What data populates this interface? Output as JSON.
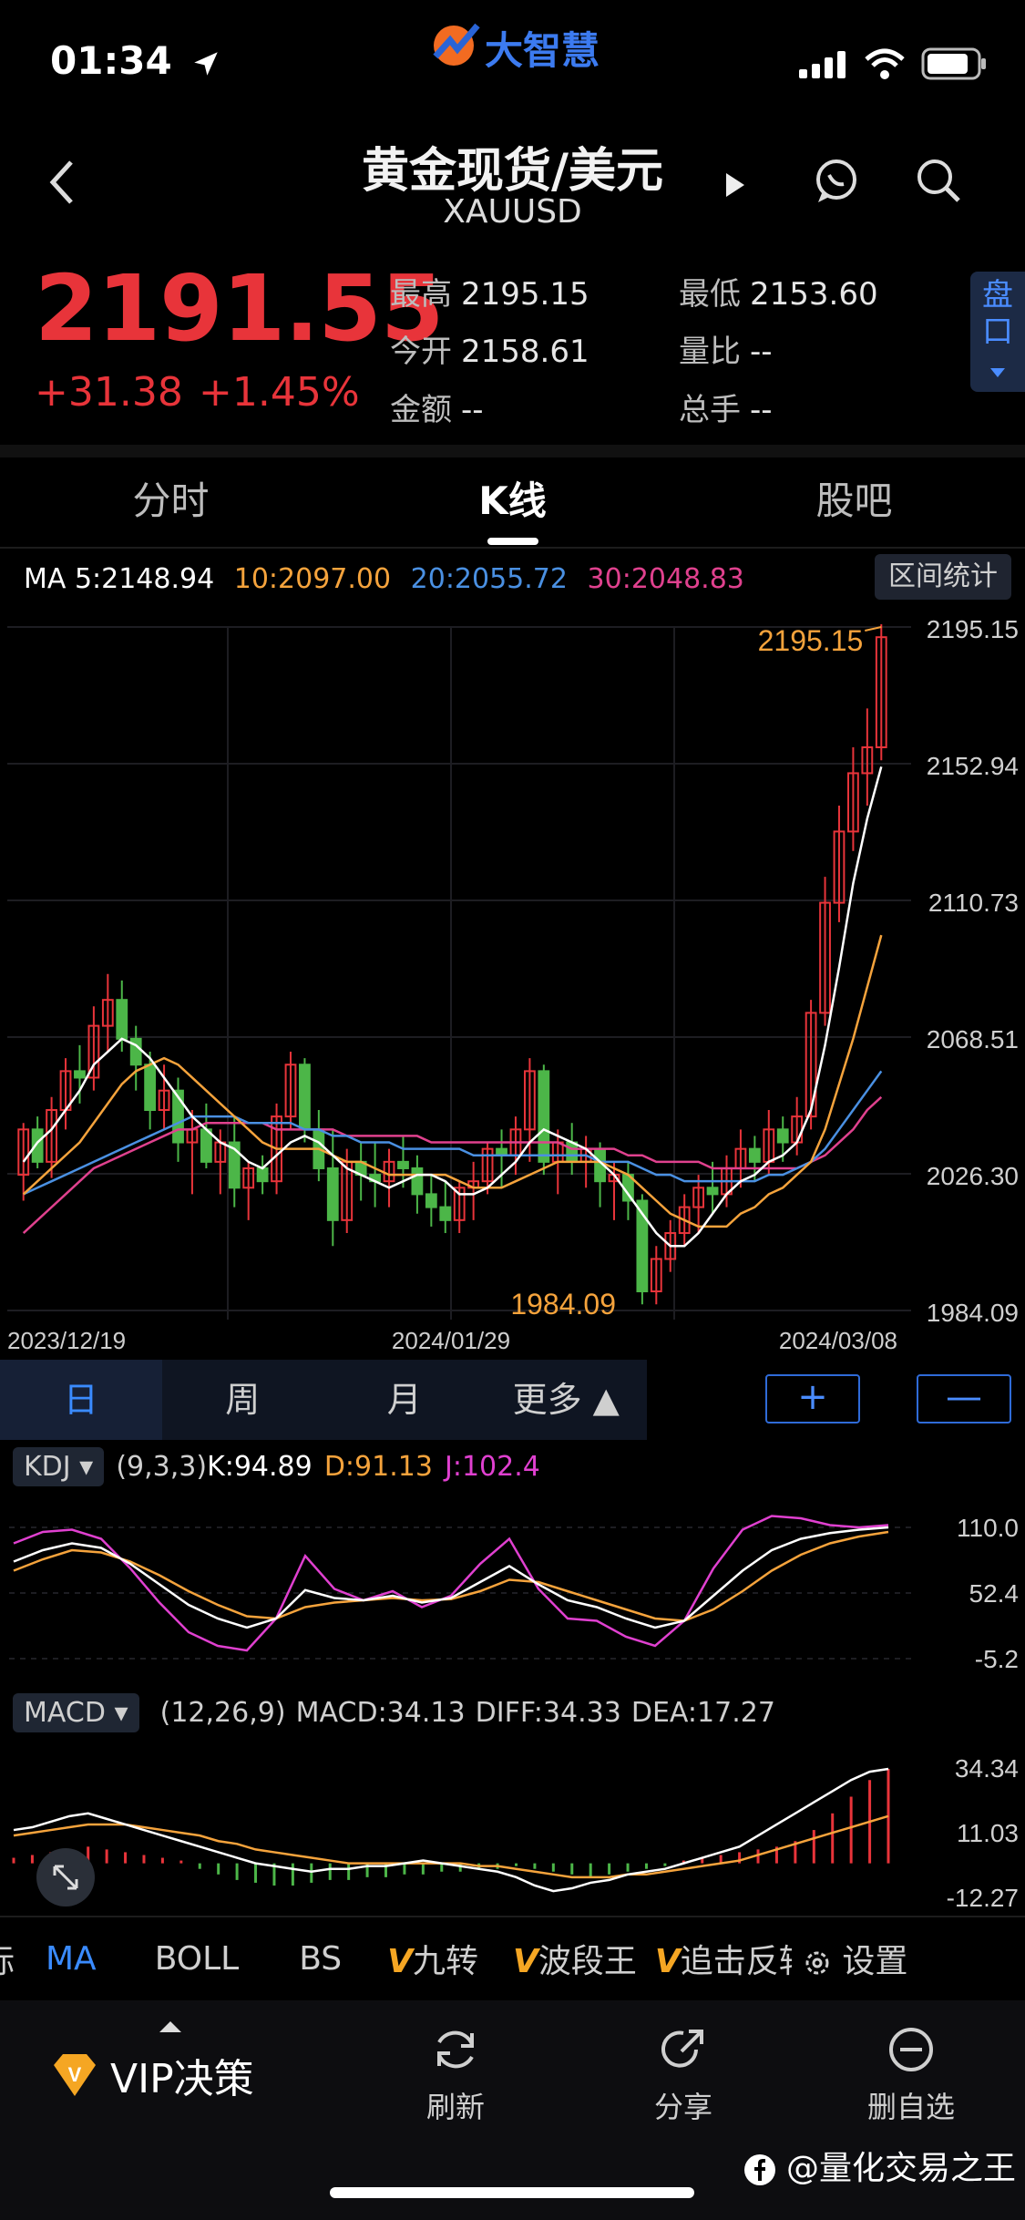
{
  "status": {
    "time": "01:34"
  },
  "app": {
    "logo_text": "大智慧"
  },
  "header": {
    "title": "黄金现货/美元",
    "symbol": "XAUUSD"
  },
  "quote": {
    "price": "2191.55",
    "change": "+31.38",
    "change_pct": "+1.45%",
    "stats": {
      "high_label": "最高",
      "high": "2195.15",
      "low_label": "最低",
      "low": "2153.60",
      "open_label": "今开",
      "open": "2158.61",
      "ratio_label": "量比",
      "ratio": "--",
      "amount_label": "金额",
      "amount": "--",
      "volume_label": "总手",
      "volume": "--"
    },
    "pankou": "盘口"
  },
  "tabs": [
    {
      "label": "分时"
    },
    {
      "label": "K线"
    },
    {
      "label": "股吧"
    }
  ],
  "ma_legend": {
    "ma5": "MA 5:2148.94",
    "ma10": "10:2097.00",
    "ma20": "20:2055.72",
    "ma30": "30:2048.83"
  },
  "range_stats_label": "区间统计",
  "colors": {
    "up": "#e8343a",
    "down": "#4cb648",
    "ma5": "#ffffff",
    "ma10": "#f5a33c",
    "ma20": "#4a90e2",
    "ma30": "#e0418e",
    "accent": "#3a8bff"
  },
  "chart_data": {
    "type": "candlestick",
    "y_ticks": [
      "2195.15",
      "2152.94",
      "2110.73",
      "2068.51",
      "2026.30",
      "1984.09"
    ],
    "x_ticks": [
      "2023/12/19",
      "2024/01/29",
      "2024/03/08"
    ],
    "max_label": "2195.15",
    "min_label": "1984.09",
    "ylim": [
      1984.09,
      2195.15
    ],
    "candles": [
      [
        2026,
        2042,
        2018,
        2040
      ],
      [
        2040,
        2044,
        2028,
        2030
      ],
      [
        2030,
        2050,
        2025,
        2046
      ],
      [
        2046,
        2062,
        2040,
        2058
      ],
      [
        2058,
        2066,
        2048,
        2056
      ],
      [
        2056,
        2078,
        2052,
        2072
      ],
      [
        2072,
        2088,
        2064,
        2080
      ],
      [
        2080,
        2086,
        2064,
        2068
      ],
      [
        2068,
        2072,
        2052,
        2060
      ],
      [
        2060,
        2064,
        2040,
        2046
      ],
      [
        2046,
        2060,
        2040,
        2052
      ],
      [
        2052,
        2056,
        2030,
        2036
      ],
      [
        2036,
        2046,
        2020,
        2040
      ],
      [
        2040,
        2048,
        2028,
        2030
      ],
      [
        2030,
        2040,
        2020,
        2036
      ],
      [
        2036,
        2044,
        2016,
        2022
      ],
      [
        2022,
        2030,
        2012,
        2028
      ],
      [
        2028,
        2032,
        2020,
        2024
      ],
      [
        2024,
        2048,
        2020,
        2044
      ],
      [
        2044,
        2064,
        2040,
        2060
      ],
      [
        2060,
        2062,
        2036,
        2040
      ],
      [
        2040,
        2046,
        2024,
        2028
      ],
      [
        2028,
        2040,
        2004,
        2012
      ],
      [
        2012,
        2034,
        2008,
        2030
      ],
      [
        2030,
        2036,
        2018,
        2026
      ],
      [
        2026,
        2036,
        2016,
        2024
      ],
      [
        2024,
        2034,
        2016,
        2030
      ],
      [
        2030,
        2038,
        2022,
        2028
      ],
      [
        2028,
        2032,
        2014,
        2020
      ],
      [
        2020,
        2026,
        2010,
        2016
      ],
      [
        2016,
        2024,
        2008,
        2012
      ],
      [
        2012,
        2024,
        2008,
        2022
      ],
      [
        2022,
        2030,
        2012,
        2024
      ],
      [
        2024,
        2036,
        2020,
        2034
      ],
      [
        2034,
        2040,
        2022,
        2032
      ],
      [
        2032,
        2044,
        2026,
        2040
      ],
      [
        2040,
        2062,
        2030,
        2058
      ],
      [
        2058,
        2060,
        2026,
        2030
      ],
      [
        2030,
        2040,
        2020,
        2036
      ],
      [
        2036,
        2042,
        2026,
        2030
      ],
      [
        2030,
        2038,
        2022,
        2034
      ],
      [
        2034,
        2036,
        2016,
        2024
      ],
      [
        2024,
        2030,
        2012,
        2026
      ],
      [
        2026,
        2030,
        2012,
        2018
      ],
      [
        2018,
        2020,
        1986,
        1990
      ],
      [
        1990,
        2004,
        1986,
        2000
      ],
      [
        2000,
        2012,
        1996,
        2008
      ],
      [
        2008,
        2020,
        2004,
        2016
      ],
      [
        2016,
        2026,
        2008,
        2022
      ],
      [
        2022,
        2030,
        2014,
        2020
      ],
      [
        2020,
        2032,
        2016,
        2028
      ],
      [
        2028,
        2040,
        2022,
        2034
      ],
      [
        2034,
        2038,
        2024,
        2030
      ],
      [
        2030,
        2046,
        2026,
        2040
      ],
      [
        2040,
        2044,
        2030,
        2036
      ],
      [
        2036,
        2050,
        2032,
        2044
      ],
      [
        2044,
        2080,
        2040,
        2076
      ],
      [
        2076,
        2118,
        2072,
        2110
      ],
      [
        2110,
        2140,
        2104,
        2132
      ],
      [
        2132,
        2158,
        2126,
        2150
      ],
      [
        2150,
        2170,
        2140,
        2158
      ],
      [
        2158,
        2196,
        2154,
        2192
      ]
    ],
    "ma5": [
      2030,
      2036,
      2040,
      2046,
      2052,
      2060,
      2064,
      2068,
      2066,
      2062,
      2056,
      2050,
      2044,
      2040,
      2036,
      2034,
      2030,
      2028,
      2032,
      2036,
      2038,
      2036,
      2032,
      2028,
      2026,
      2024,
      2022,
      2024,
      2026,
      2026,
      2024,
      2020,
      2020,
      2022,
      2026,
      2030,
      2036,
      2040,
      2038,
      2036,
      2034,
      2030,
      2026,
      2020,
      2014,
      2008,
      2004,
      2004,
      2008,
      2014,
      2020,
      2024,
      2026,
      2030,
      2032,
      2036,
      2046,
      2066,
      2090,
      2116,
      2136,
      2152
    ],
    "ma10": [
      2020,
      2024,
      2028,
      2032,
      2036,
      2042,
      2048,
      2054,
      2058,
      2060,
      2062,
      2060,
      2056,
      2052,
      2048,
      2044,
      2040,
      2036,
      2034,
      2034,
      2034,
      2034,
      2032,
      2030,
      2030,
      2028,
      2026,
      2026,
      2026,
      2026,
      2026,
      2024,
      2022,
      2022,
      2022,
      2024,
      2026,
      2028,
      2030,
      2030,
      2030,
      2030,
      2028,
      2026,
      2022,
      2018,
      2014,
      2012,
      2010,
      2010,
      2010,
      2014,
      2016,
      2020,
      2022,
      2026,
      2030,
      2040,
      2054,
      2068,
      2084,
      2100
    ],
    "ma20": [
      2020,
      2022,
      2024,
      2026,
      2028,
      2030,
      2032,
      2034,
      2036,
      2038,
      2040,
      2042,
      2044,
      2044,
      2044,
      2044,
      2042,
      2042,
      2042,
      2042,
      2040,
      2040,
      2038,
      2038,
      2036,
      2036,
      2036,
      2034,
      2034,
      2034,
      2034,
      2034,
      2032,
      2032,
      2032,
      2032,
      2032,
      2032,
      2032,
      2032,
      2032,
      2030,
      2030,
      2030,
      2028,
      2026,
      2026,
      2024,
      2024,
      2024,
      2024,
      2024,
      2024,
      2026,
      2026,
      2028,
      2030,
      2034,
      2040,
      2046,
      2052,
      2058
    ],
    "ma30": [
      2008,
      2012,
      2016,
      2020,
      2024,
      2028,
      2030,
      2032,
      2034,
      2036,
      2038,
      2040,
      2040,
      2042,
      2042,
      2042,
      2042,
      2042,
      2040,
      2040,
      2040,
      2040,
      2040,
      2038,
      2038,
      2038,
      2038,
      2038,
      2038,
      2036,
      2036,
      2036,
      2036,
      2036,
      2036,
      2036,
      2036,
      2036,
      2036,
      2034,
      2034,
      2034,
      2034,
      2032,
      2032,
      2030,
      2030,
      2030,
      2030,
      2028,
      2028,
      2028,
      2028,
      2028,
      2028,
      2028,
      2030,
      2032,
      2036,
      2040,
      2046,
      2050
    ]
  },
  "periods": [
    {
      "label": "日"
    },
    {
      "label": "周"
    },
    {
      "label": "月"
    },
    {
      "label": "更多 ▲"
    }
  ],
  "zoom": {
    "plus": "+",
    "minus": "—"
  },
  "kdj": {
    "tag": "KDJ ▾",
    "params": "(9,3,3)",
    "k": "K:94.89",
    "d": "D:91.13",
    "j": "J:102.4",
    "y_ticks": [
      "110.0",
      "52.4",
      "-5.2"
    ],
    "ylim": [
      -5.2,
      110.0
    ],
    "k_series": [
      80,
      90,
      96,
      92,
      78,
      60,
      42,
      30,
      22,
      30,
      55,
      48,
      46,
      50,
      44,
      48,
      62,
      76,
      60,
      46,
      40,
      30,
      22,
      28,
      50,
      72,
      90,
      100,
      105,
      108,
      110
    ],
    "d_series": [
      72,
      82,
      90,
      88,
      80,
      68,
      54,
      42,
      32,
      30,
      40,
      44,
      46,
      48,
      46,
      47,
      54,
      64,
      62,
      54,
      46,
      38,
      30,
      28,
      38,
      54,
      72,
      86,
      96,
      102,
      106
    ],
    "j_series": [
      96,
      106,
      108,
      100,
      74,
      44,
      18,
      6,
      2,
      30,
      85,
      56,
      46,
      54,
      40,
      50,
      78,
      100,
      56,
      30,
      28,
      14,
      6,
      28,
      74,
      108,
      120,
      118,
      112,
      110,
      112
    ]
  },
  "macd": {
    "tag": "MACD ▾",
    "params": "(12,26,9)",
    "macd": "MACD:34.13",
    "diff": "DIFF:34.33",
    "dea": "DEA:17.27",
    "y_ticks": [
      "34.34",
      "11.03",
      "-12.27"
    ],
    "ylim": [
      -12.27,
      34.34
    ],
    "hist": [
      2,
      3,
      4,
      5,
      6,
      5,
      4,
      3,
      2,
      1,
      -2,
      -4,
      -6,
      -7,
      -8,
      -8,
      -7,
      -6,
      -6,
      -5,
      -5,
      -4,
      -4,
      -3,
      -3,
      -2,
      -2,
      -1,
      -2,
      -3,
      -4,
      -5,
      -4,
      -3,
      -2,
      -1,
      1,
      2,
      3,
      4,
      5,
      6,
      8,
      12,
      18,
      24,
      30,
      34
    ],
    "diff_series": [
      12,
      13,
      15,
      17,
      18,
      16,
      14,
      12,
      10,
      8,
      6,
      4,
      2,
      0,
      -1,
      -2,
      -3,
      -2,
      -2,
      -1,
      -1,
      0,
      1,
      0,
      -1,
      -2,
      -3,
      -5,
      -8,
      -10,
      -9,
      -7,
      -6,
      -4,
      -3,
      -2,
      0,
      2,
      4,
      6,
      10,
      14,
      18,
      22,
      26,
      30,
      33,
      34
    ],
    "dea_series": [
      10,
      11,
      12,
      13,
      14,
      14,
      14,
      13,
      12,
      11,
      10,
      8,
      7,
      5,
      4,
      3,
      2,
      1,
      0,
      0,
      0,
      0,
      0,
      0,
      0,
      -1,
      -1,
      -2,
      -3,
      -4,
      -5,
      -5,
      -5,
      -4,
      -4,
      -3,
      -2,
      -1,
      0,
      1,
      3,
      5,
      7,
      9,
      11,
      13,
      15,
      17
    ]
  },
  "indicators": [
    {
      "label": "标"
    },
    {
      "label": "MA"
    },
    {
      "label": "BOLL"
    },
    {
      "label": "BS"
    },
    {
      "label": "九转"
    },
    {
      "label": "波段王"
    },
    {
      "label": "追击反转"
    },
    {
      "label": "设置"
    }
  ],
  "bottom": {
    "vip": "VIP决策",
    "refresh": "刷新",
    "share": "分享",
    "remove": "删自选"
  },
  "watermark": "@量化交易之王"
}
